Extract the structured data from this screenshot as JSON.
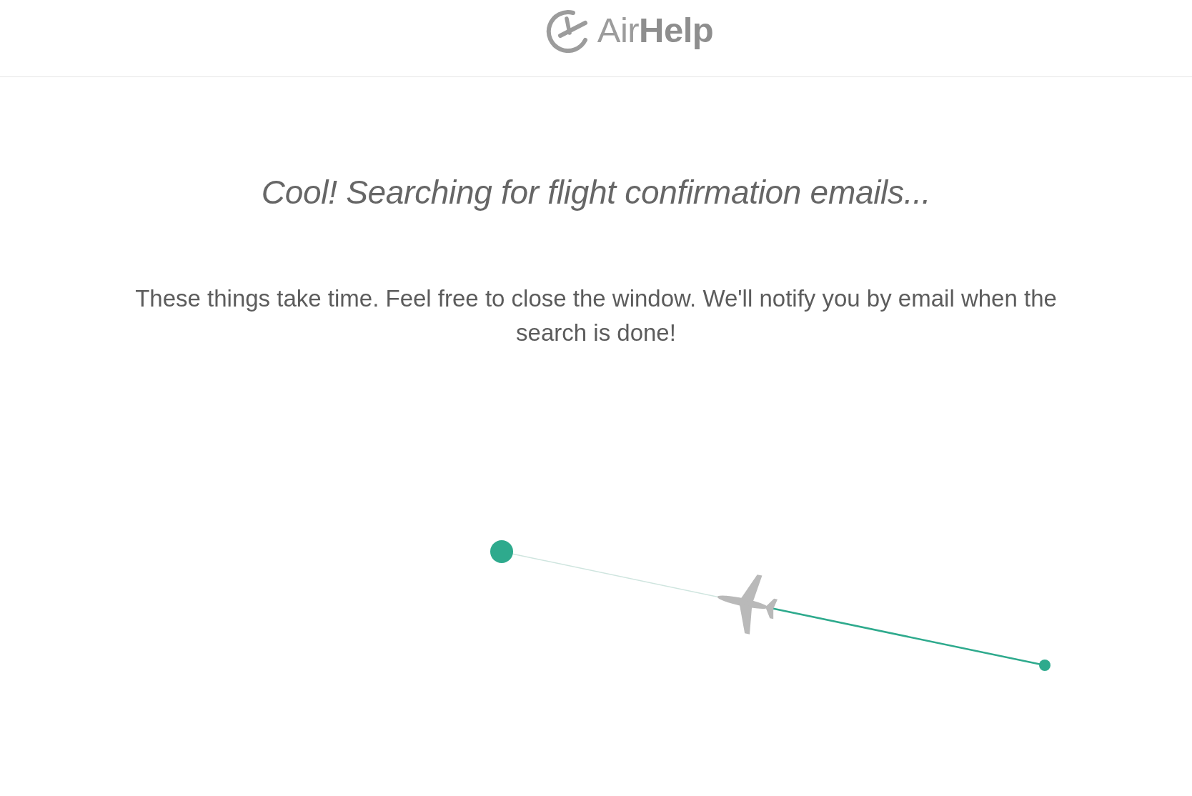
{
  "header": {
    "logo": "Air**Help**"
  },
  "heading": "Cool! Searching for flight confirmation emails...",
  "message": "These things take time. Feel free to close the window. We'll notify you by email when the search is done!"
}
